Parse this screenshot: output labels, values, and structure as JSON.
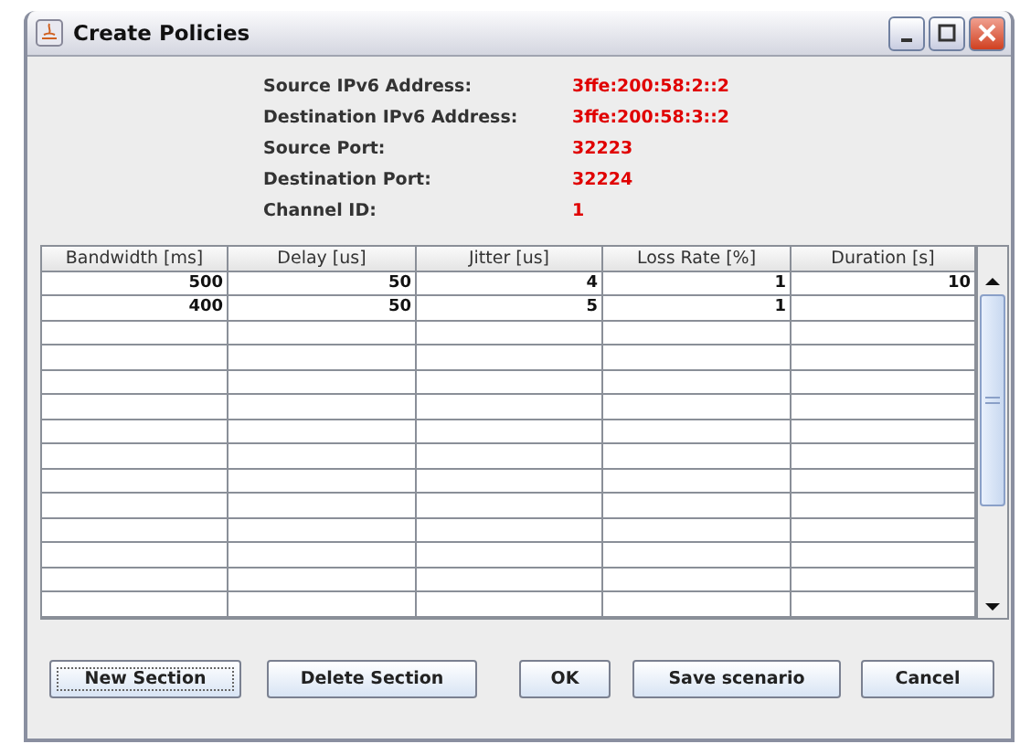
{
  "window": {
    "title": "Create Policies"
  },
  "info": [
    {
      "label": "Source IPv6 Address:",
      "value": "3ffe:200:58:2::2"
    },
    {
      "label": "Destination IPv6 Address:",
      "value": "3ffe:200:58:3::2"
    },
    {
      "label": "Source Port:",
      "value": "32223"
    },
    {
      "label": "Destination Port:",
      "value": "32224"
    },
    {
      "label": "Channel ID:",
      "value": "1"
    }
  ],
  "table": {
    "columns": [
      "Bandwidth [ms]",
      "Delay [us]",
      "Jitter [us]",
      "Loss Rate [%]",
      "Duration [s]"
    ],
    "rows": [
      [
        "500",
        "50",
        "4",
        "1",
        "10"
      ],
      [
        "400",
        "50",
        "5",
        "1",
        null
      ]
    ]
  },
  "buttons": [
    {
      "label": "New Section",
      "focused": true
    },
    {
      "label": "Delete Section",
      "focused": false
    },
    {
      "label": "OK",
      "focused": false
    },
    {
      "label": "Save scenario",
      "focused": false
    },
    {
      "label": "Cancel",
      "focused": false
    }
  ]
}
